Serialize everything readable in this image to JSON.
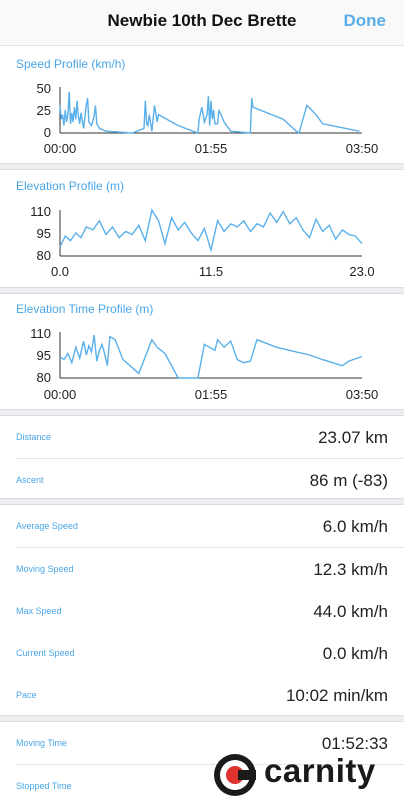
{
  "header": {
    "title": "Newbie 10th Dec Brette",
    "done_label": "Done"
  },
  "colors": {
    "accent": "#4aa6e6",
    "line": "#5ab0ea"
  },
  "speed_chart": {
    "title": "Speed Profile (km/h)",
    "y_ticks": [
      "50",
      "25",
      "0"
    ],
    "x_ticks": [
      "00:00",
      "01:55",
      "03:50"
    ],
    "chart_data": {
      "type": "line",
      "xlabel": "Time",
      "ylabel": "Speed (km/h)",
      "ylim": [
        0,
        50
      ],
      "x_unit": "minutes",
      "xlim": [
        0,
        230
      ],
      "x": [
        0,
        1,
        2,
        3,
        4,
        5,
        6,
        7,
        8,
        9,
        10,
        11,
        12,
        13,
        14,
        15,
        16,
        18,
        20,
        21,
        22,
        24,
        26,
        27,
        28,
        30,
        35,
        45,
        55,
        64,
        65,
        66,
        67,
        68,
        70,
        72,
        74,
        75,
        90,
        105,
        106,
        108,
        110,
        112,
        113,
        114,
        115,
        116,
        117,
        118,
        120,
        121,
        125,
        130,
        145,
        146,
        147,
        170,
        180,
        182,
        188,
        195,
        200,
        228
      ],
      "y": [
        30,
        15,
        20,
        8,
        25,
        12,
        20,
        45,
        10,
        22,
        12,
        28,
        15,
        35,
        18,
        10,
        22,
        5,
        30,
        38,
        12,
        8,
        18,
        30,
        10,
        5,
        2,
        1,
        0,
        5,
        35,
        10,
        8,
        20,
        2,
        30,
        12,
        20,
        8,
        0,
        15,
        28,
        12,
        20,
        40,
        8,
        35,
        15,
        25,
        10,
        10,
        25,
        12,
        2,
        0,
        38,
        28,
        15,
        2,
        0,
        30,
        20,
        10,
        2
      ]
    }
  },
  "elevation_chart": {
    "title": "Elevation Profile (m)",
    "y_ticks": [
      "110",
      "95",
      "80"
    ],
    "x_ticks": [
      "0.0",
      "11.5",
      "23.0"
    ],
    "chart_data": {
      "type": "line",
      "xlabel": "Distance",
      "ylabel": "Elevation (m)",
      "ylim": [
        80,
        110
      ],
      "xlim": [
        0,
        23
      ],
      "x": [
        0.0,
        0.4,
        0.8,
        1.2,
        1.6,
        2.0,
        2.5,
        3.0,
        3.5,
        4.0,
        4.5,
        5.0,
        5.5,
        6.0,
        6.5,
        7.0,
        7.5,
        8.0,
        8.5,
        9.0,
        9.5,
        10.0,
        10.5,
        11.0,
        11.5,
        12.0,
        12.5,
        13.0,
        13.5,
        14.0,
        14.5,
        15.0,
        15.5,
        16.0,
        16.5,
        17.0,
        17.5,
        18.0,
        18.5,
        19.0,
        19.5,
        20.0,
        20.5,
        21.0,
        21.5,
        22.0,
        22.5,
        23.0
      ],
      "y": [
        86,
        93,
        90,
        95,
        92,
        99,
        97,
        103,
        94,
        99,
        92,
        96,
        94,
        100,
        90,
        110,
        103,
        88,
        105,
        97,
        102,
        95,
        90,
        98,
        84,
        103,
        96,
        101,
        99,
        103,
        96,
        101,
        99,
        108,
        102,
        109,
        101,
        105,
        97,
        92,
        104,
        96,
        100,
        91,
        97,
        94,
        93,
        88
      ]
    }
  },
  "elevation_time_chart": {
    "title": "Elevation Time Profile (m)",
    "y_ticks": [
      "110",
      "95",
      "80"
    ],
    "x_ticks": [
      "00:00",
      "01:55",
      "03:50"
    ],
    "chart_data": {
      "type": "line",
      "xlabel": "Time",
      "ylabel": "Elevation (m)",
      "ylim": [
        80,
        110
      ],
      "x_unit": "minutes",
      "xlim": [
        0,
        230
      ],
      "x": [
        0,
        3,
        6,
        9,
        12,
        15,
        18,
        20,
        22,
        24,
        26,
        28,
        30,
        32,
        34,
        36,
        38,
        40,
        42,
        48,
        60,
        70,
        74,
        80,
        90,
        100,
        105,
        110,
        118,
        120,
        125,
        130,
        135,
        140,
        145,
        150,
        165,
        175,
        190,
        200,
        215,
        220,
        230
      ],
      "y": [
        94,
        92,
        96,
        90,
        100,
        93,
        104,
        95,
        101,
        97,
        108,
        91,
        98,
        102,
        96,
        88,
        107,
        106,
        105,
        92,
        83,
        105,
        100,
        96,
        80,
        79,
        80,
        102,
        98,
        105,
        100,
        104,
        92,
        90,
        91,
        105,
        100,
        98,
        95,
        92,
        88,
        91,
        94
      ]
    }
  },
  "stats_group1": [
    {
      "label": "Distance",
      "value": "23.07 km"
    },
    {
      "label": "Ascent",
      "value": "86 m (-83)"
    }
  ],
  "stats_group2": [
    {
      "label": "Average Speed",
      "value": "6.0 km/h"
    },
    {
      "label": "Moving Speed",
      "value": "12.3 km/h"
    },
    {
      "label": "Max Speed",
      "value": "44.0 km/h"
    },
    {
      "label": "Current Speed",
      "value": "0.0 km/h"
    },
    {
      "label": "Pace",
      "value": "10:02 min/km"
    }
  ],
  "stats_group3": [
    {
      "label": "Moving Time",
      "value": "01:52:33"
    },
    {
      "label": "Stopped Time",
      "value": ""
    }
  ],
  "watermark": {
    "text": "carnity"
  }
}
